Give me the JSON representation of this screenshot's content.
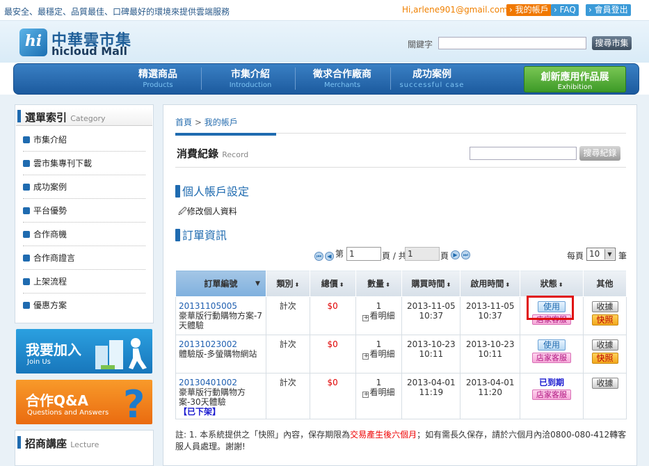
{
  "topbar": {
    "slogan": "最安全、最穩定、品質最佳、口碑最好的環境來提供雲端服務",
    "user": "Hi,arlene901@gmail.com",
    "account_btn": "我的帳戶",
    "faq_btn": "FAQ",
    "logout_btn": "會員登出"
  },
  "logo": {
    "hi": "hi",
    "cn": "中華雲市集",
    "en": "hicloud Mall"
  },
  "search": {
    "label": "關鍵字",
    "button": "搜尋市集"
  },
  "nav": [
    {
      "zh": "精選商品",
      "en": "Products"
    },
    {
      "zh": "市集介紹",
      "en": "Introduction"
    },
    {
      "zh": "徵求合作廠商",
      "en": "Merchants"
    },
    {
      "zh": "成功案例",
      "en": "successful case"
    }
  ],
  "nav_exhibition": {
    "zh": "創新應用作品展",
    "en": "Exhibition"
  },
  "sidebar": {
    "title": "選單索引",
    "title_en": "Category",
    "items": [
      "市集介紹",
      "雲市集專刊下載",
      "成功案例",
      "平台優勢",
      "合作商機",
      "合作商證言",
      "上架流程",
      "優惠方案"
    ],
    "join": {
      "zh": "我要加入",
      "en": "Join Us"
    },
    "qa": {
      "zh": "合作Q&A",
      "en": "Questions and Answers"
    },
    "lecture": {
      "zh": "招商講座",
      "en": "Lecture"
    }
  },
  "main": {
    "crumb_home": "首頁",
    "crumb_sep": ">",
    "crumb_current": "我的帳戶",
    "record_title": "消費紀錄",
    "record_title_en": "Record",
    "record_search_btn": "搜尋紀錄",
    "section_account": "個人帳戶設定",
    "edit_profile": "修改個人資料",
    "section_orders": "訂單資訊",
    "pager": {
      "prefix": "第",
      "page": "1",
      "middle": "頁 / 共",
      "total": "1",
      "suffix": "頁",
      "per_label": "每頁",
      "per_value": "10",
      "per_suffix": "筆"
    },
    "columns": [
      "訂單編號",
      "類別",
      "總價",
      "數量",
      "購買時間",
      "啟用時間",
      "狀態",
      "其他"
    ],
    "rows": [
      {
        "id": "20131105005",
        "name": "豪華版行動購物方案-7天體驗",
        "type": "計次",
        "price": "$0",
        "qty": "1",
        "detail": "看明細",
        "buy": "2013-11-05",
        "buy_time": "10:37",
        "start": "2013-11-05",
        "start_time": "10:37",
        "status": "使用",
        "cs": "店家客服",
        "rcv": "收據",
        "snap": "快照"
      },
      {
        "id": "20131023002",
        "name": "體驗版-多螢購物網站",
        "type": "計次",
        "price": "$0",
        "qty": "1",
        "detail": "看明細",
        "buy": "2013-10-23",
        "buy_time": "10:11",
        "start": "2013-10-23",
        "start_time": "10:11",
        "status": "使用",
        "cs": "店家客服",
        "rcv": "收據",
        "snap": "快照"
      },
      {
        "id": "20130401002",
        "name": "豪華版行動購物方案-30天體驗",
        "type": "計次",
        "price": "$0",
        "qty": "1",
        "detail": "看明細",
        "buy": "2013-04-01",
        "buy_time": "11:19",
        "start": "2013-04-01",
        "start_time": "11:20",
        "status": "已到期",
        "cs": "店家客服",
        "rcv": "收據",
        "offshelf": "【已下架】"
      }
    ],
    "note_a": "註: 1. 本系統提供之「快照」內容，保存期限為",
    "note_hl": "交易產生後六個月",
    "note_b": "；如有需長久保存，請於六個月內洽0800-080-412轉客服人員處理。謝謝!"
  }
}
